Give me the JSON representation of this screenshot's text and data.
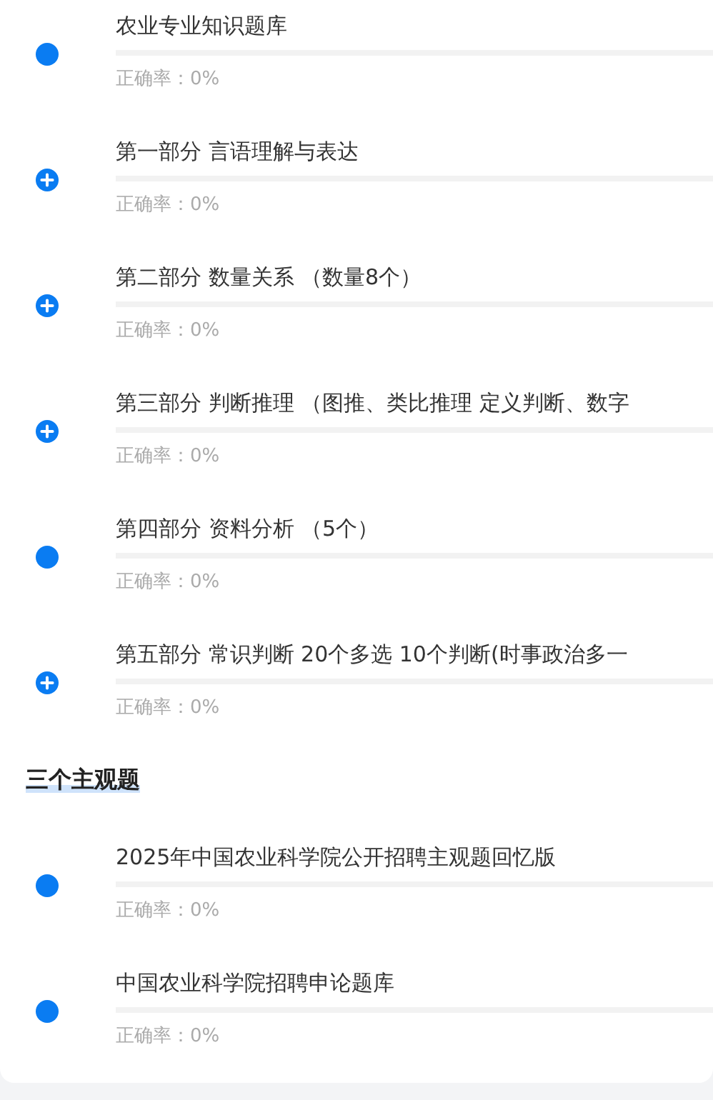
{
  "sections": [
    {
      "items": [
        {
          "kind": "leaf",
          "title": "农业专业知识题库",
          "level": 0,
          "accuracy": "正确率：0%"
        },
        {
          "kind": "expandable",
          "title": "第一部分 言语理解与表达",
          "level": 0,
          "accuracy": "正确率：0%"
        },
        {
          "kind": "expandable",
          "title": "第二部分 数量关系 （数量8个）",
          "level": 0,
          "accuracy": "正确率：0%"
        },
        {
          "kind": "expandable",
          "title": "第三部分 判断推理 （图推、类比推理 定义判断、数字",
          "level": 0,
          "accuracy": "正确率：0%"
        },
        {
          "kind": "leaf",
          "title": "第四部分 资料分析 （5个）",
          "level": 0,
          "accuracy": "正确率：0%"
        },
        {
          "kind": "expandable",
          "title": "第五部分 常识判断 20个多选 10个判断(时事政治多一",
          "level": 0,
          "accuracy": "正确率：0%"
        }
      ]
    },
    {
      "title": "三个主观题",
      "items": [
        {
          "kind": "leaf",
          "title": "2025年中国农业科学院公开招聘主观题回忆版",
          "level": 0,
          "accuracy": "正确率：0%"
        },
        {
          "kind": "leaf",
          "title": "中国农业科学院招聘申论题库",
          "level": 0,
          "accuracy": "正确率：0%"
        }
      ]
    }
  ]
}
